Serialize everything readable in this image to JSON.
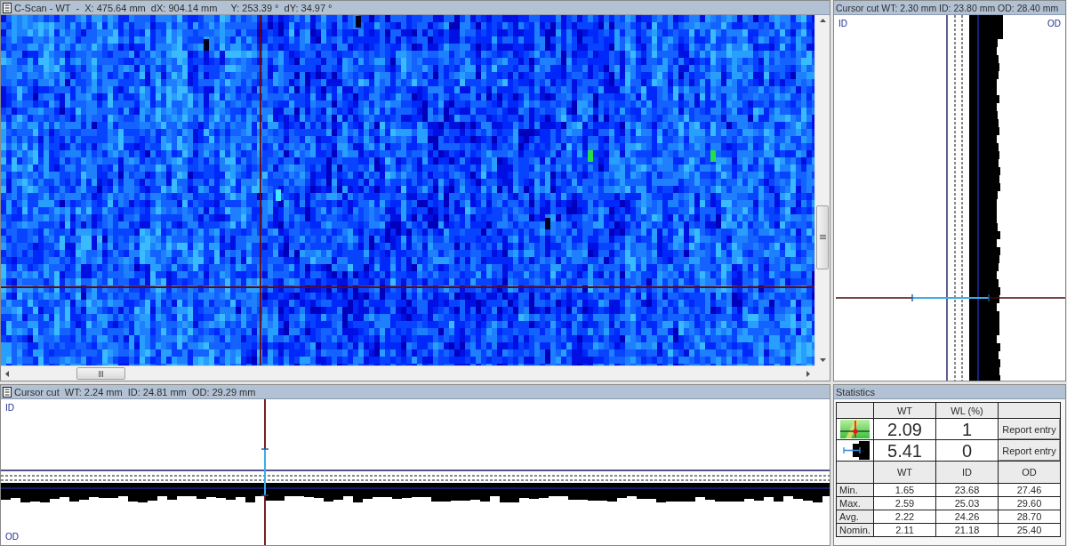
{
  "c_scan": {
    "title": "C-Scan - WT  -  X: 475.64 mm  dX: 904.14 mm     Y: 253.39 °  dY: 34.97 °",
    "menu_button": true
  },
  "side_cursor_cut": {
    "title": "Cursor cut WT: 2.30 mm ID: 23.80 mm OD: 28.40 mm",
    "menu_button": false,
    "inner_label": "ID",
    "outer_label": "OD"
  },
  "bottom_cursor_cut": {
    "title": "Cursor cut  WT: 2.24 mm  ID: 24.81 mm  OD: 29.29 mm",
    "menu_button": true,
    "inner_label": "ID",
    "outer_label": "OD"
  },
  "statistics": {
    "title": "Statistics",
    "menu_button": false,
    "reading_columns": [
      "WT",
      "WL (%)"
    ],
    "readings": [
      {
        "kind": "scan",
        "wt": "2.09",
        "wl": "1",
        "button": "Report entry"
      },
      {
        "kind": "profile",
        "wt": "5.41",
        "wl": "0",
        "button": "Report entry"
      }
    ],
    "summary_columns": [
      "WT",
      "ID",
      "OD"
    ],
    "summary_rows": [
      {
        "label": "Min.",
        "values": [
          "1.65",
          "23.68",
          "27.46"
        ]
      },
      {
        "label": "Max.",
        "values": [
          "2.59",
          "25.03",
          "29.60"
        ]
      },
      {
        "label": "Avg.",
        "values": [
          "2.22",
          "24.26",
          "28.70"
        ]
      },
      {
        "label": "Nomin.",
        "values": [
          "2.11",
          "21.18",
          "25.40"
        ]
      }
    ]
  }
}
